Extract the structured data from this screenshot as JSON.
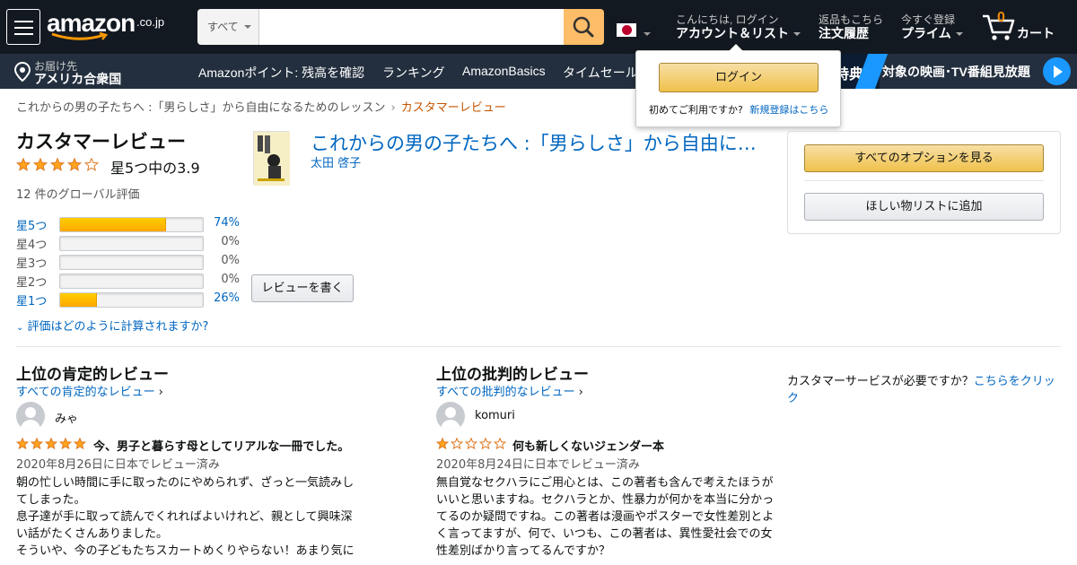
{
  "header": {
    "logo_text": "amazon",
    "logo_suffix": ".co.jp",
    "search_category": "すべて",
    "search_placeholder": "",
    "account_greeting": "こんにちは, ログイン",
    "account_label": "アカウント＆リスト",
    "orders_line1": "返品もこちら",
    "orders_line2": "注文履歴",
    "prime_line1": "今すぐ登録",
    "prime_line2": "プライム",
    "cart_count": "0",
    "cart_label": "カート"
  },
  "subnav": {
    "deliver_line1": "お届け先",
    "deliver_line2": "アメリカ合衆国",
    "items": [
      "Amazonポイント: 残高を確認",
      "ランキング",
      "AmazonBasics",
      "タイムセール"
    ],
    "promo_tokuten": "特典",
    "promo_text": "対象の映画･TV番組見放題"
  },
  "login_popover": {
    "button": "ログイン",
    "new_customer": "初めてご利用ですか?",
    "register_link": "新規登録はこちら"
  },
  "breadcrumb": {
    "parent": "これからの男の子たちへ :「男らしさ」から自由になるためのレッスン",
    "separator": "›",
    "current": "カスタマーレビュー"
  },
  "summary": {
    "title": "カスタマーレビュー",
    "rating": 3.9,
    "rating_text": "星5つ中の3.9",
    "global_count": "12 件のグローバル評価",
    "histogram": [
      {
        "label": "星5つ",
        "pct": 74,
        "pct_text": "74%",
        "linked": true
      },
      {
        "label": "星4つ",
        "pct": 0,
        "pct_text": "0%",
        "linked": false
      },
      {
        "label": "星3つ",
        "pct": 0,
        "pct_text": "0%",
        "linked": false
      },
      {
        "label": "星2つ",
        "pct": 0,
        "pct_text": "0%",
        "linked": false
      },
      {
        "label": "星1つ",
        "pct": 26,
        "pct_text": "26%",
        "linked": true
      }
    ],
    "how_calculated": "評価はどのように計算されますか?"
  },
  "product": {
    "title": "これからの男の子たちへ :「男らしさ」から自由になるためのレッスン",
    "author": "太田 啓子",
    "write_review": "レビューを書く"
  },
  "options": {
    "all_options": "すべてのオプションを見る",
    "wishlist": "ほしい物リストに追加"
  },
  "reviews": {
    "positive_heading": "上位の肯定的レビュー",
    "positive_link": "すべての肯定的なレビュー",
    "critical_heading": "上位の批判的レビュー",
    "critical_link": "すべての批判的なレビュー",
    "positive": {
      "author": "みゃ",
      "stars": 5,
      "title": "今、男子と暮らす母としてリアルな一冊でした。",
      "date": "2020年8月26日に日本でレビュー済み",
      "body": [
        "朝の忙しい時間に手に取ったのにやめられず、ざっと一気読みし",
        "てしまった。",
        "息子達が手に取って読んでくれればよいけれど、親として興味深",
        "い話がたくさんありました。",
        "そういや、今の子どもたちスカートめくりやらない！あまり気に"
      ]
    },
    "critical": {
      "author": "komuri",
      "stars": 1,
      "title": "何も新しくないジェンダー本",
      "date": "2020年8月24日に日本でレビュー済み",
      "body": [
        "無自覚なセクハラにご用心とは、この著者も含んで考えたほうが",
        "いいと思いますね。セクハラとか、性暴力が何かを本当に分かっ",
        "てるのか疑問ですね。この著者は漫画やポスターで女性差別とよ",
        "く言ってますが、何で、いつも、この著者は、異性愛社会での女",
        "性差別ばかり言ってるんですか？"
      ]
    }
  },
  "customer_service": {
    "text": "カスタマーサービスが必要ですか？",
    "link": "こちらをクリック"
  },
  "colors": {
    "nav_dark": "#131921",
    "nav_sub": "#232f3e",
    "star": "#ffa41c",
    "link": "#0066c0",
    "breadcrumb_current": "#c45500"
  }
}
